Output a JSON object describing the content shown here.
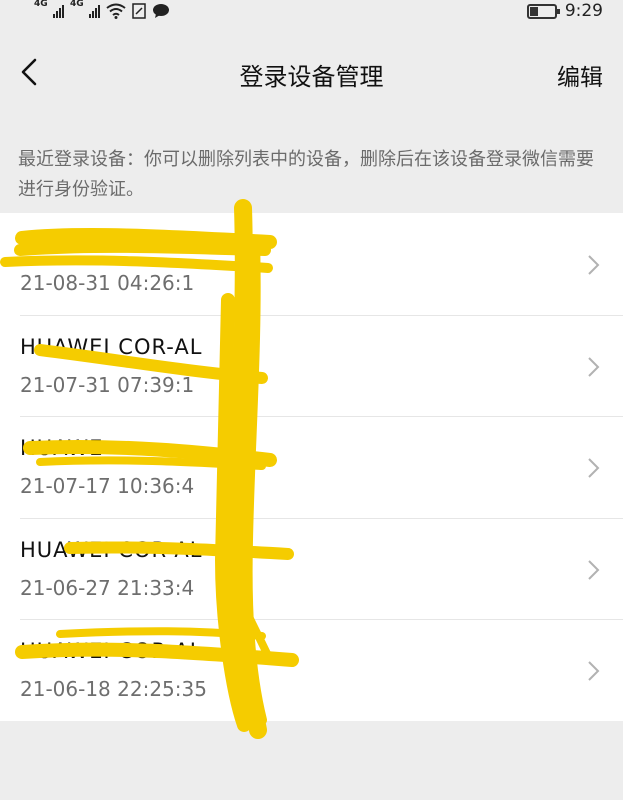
{
  "status_bar": {
    "signal_1": "4G",
    "signal_2": "4G",
    "time": "9:29"
  },
  "nav": {
    "title": "登录设备管理",
    "edit_label": "编辑"
  },
  "hint": "最近登录设备：你可以删除列表中的设备，删除后在该设备登录微信需要进行身份验证。",
  "devices": [
    {
      "name": "H",
      "time": "21-08-31 04:26:1"
    },
    {
      "name": "HUAWEI COR-AL",
      "time": "21-07-31 07:39:1"
    },
    {
      "name": "HUAWE",
      "time": "21-07-17 10:36:4"
    },
    {
      "name": "HUAWEI COR-AL",
      "time": "21-06-27 21:33:4"
    },
    {
      "name": "HUAWEI COR-AL",
      "time": "21-06-18 22:25:35"
    }
  ],
  "colors": {
    "background": "#ededed",
    "list_bg": "#ffffff",
    "scribble": "#f5cc00",
    "hint_text": "#6b6b6b"
  }
}
